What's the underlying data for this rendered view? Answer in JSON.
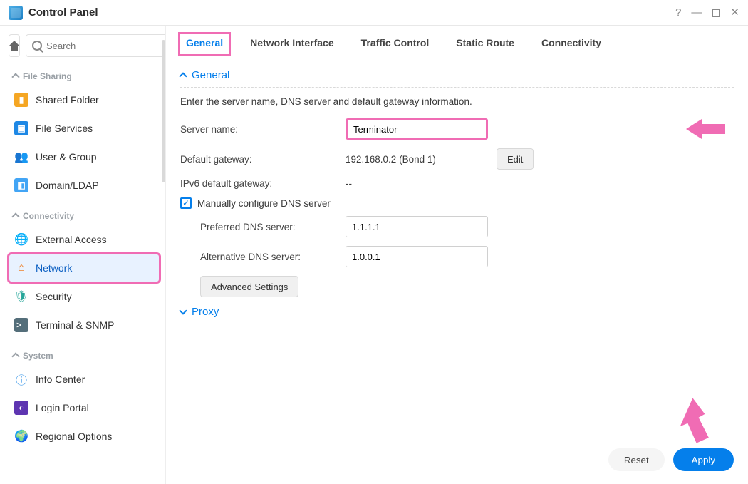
{
  "titlebar": {
    "title": "Control Panel"
  },
  "search": {
    "placeholder": "Search"
  },
  "sidebar": {
    "sections": {
      "fileSharing": {
        "label": "File Sharing"
      },
      "connectivity": {
        "label": "Connectivity"
      },
      "system": {
        "label": "System"
      }
    },
    "items": {
      "sharedFolder": "Shared Folder",
      "fileServices": "File Services",
      "userGroup": "User & Group",
      "domainLdap": "Domain/LDAP",
      "externalAccess": "External Access",
      "network": "Network",
      "security": "Security",
      "terminalSnmp": "Terminal & SNMP",
      "infoCenter": "Info Center",
      "loginPortal": "Login Portal",
      "regionalOptions": "Regional Options"
    }
  },
  "tabs": {
    "general": "General",
    "networkInterface": "Network Interface",
    "trafficControl": "Traffic Control",
    "staticRoute": "Static Route",
    "connectivity": "Connectivity"
  },
  "general": {
    "section_title": "General",
    "intro": "Enter the server name, DNS server and default gateway information.",
    "server_name_label": "Server name:",
    "server_name_value": "Terminator",
    "default_gateway_label": "Default gateway:",
    "default_gateway_value": "192.168.0.2 (Bond 1)",
    "edit_button": "Edit",
    "ipv6_gateway_label": "IPv6 default gateway:",
    "ipv6_gateway_value": "--",
    "manual_dns_checkbox": "Manually configure DNS server",
    "preferred_dns_label": "Preferred DNS server:",
    "preferred_dns_value": "1.1.1.1",
    "alternative_dns_label": "Alternative DNS server:",
    "alternative_dns_value": "1.0.0.1",
    "advanced_button": "Advanced Settings",
    "proxy_section": "Proxy"
  },
  "footer": {
    "reset": "Reset",
    "apply": "Apply"
  }
}
